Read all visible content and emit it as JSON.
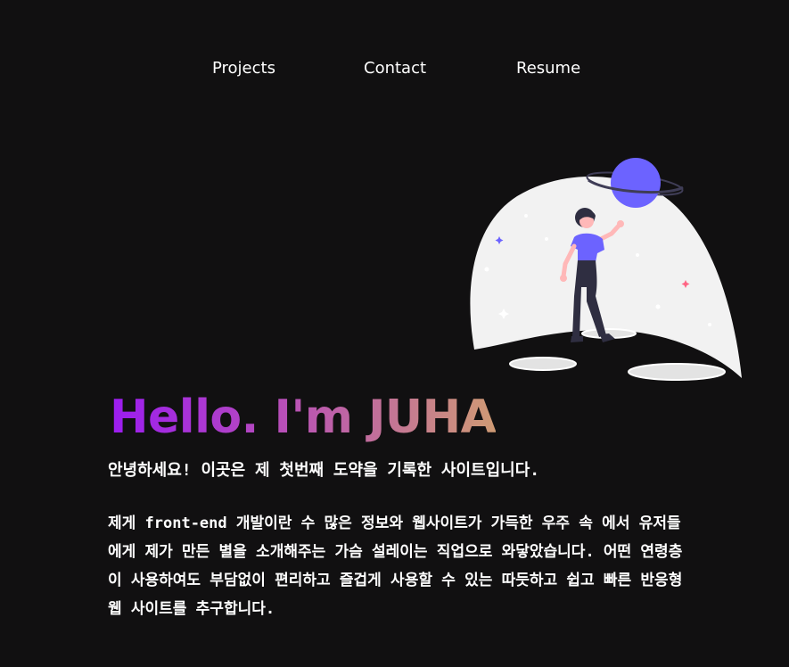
{
  "nav": {
    "items": [
      {
        "label": "Projects"
      },
      {
        "label": "Contact"
      },
      {
        "label": "Resume"
      }
    ]
  },
  "hero": {
    "title": "Hello. I'm JUHA",
    "intro": "안녕하세요! 이곳은 제 첫번째 도약을 기록한 사이트입니다.",
    "description": "제게 front-end 개발이란 수 많은 정보와 웹사이트가 가득한 우주 속 에서 유저들에게 제가 만든 별을 소개해주는 가슴 설레이는 직업으로 와닿았습니다. 어떤 연령층이 사용하여도 부담없이 편리하고 즐겁게 사용할 수 있는 따듯하고 쉽고 빠른 반응형 웹 사이트를 추구합니다."
  },
  "theme": {
    "background": "#111011",
    "planet_color": "#6c63ff",
    "title_gradient": [
      "#9b1cf0",
      "#b84fb8",
      "#cf9a74"
    ],
    "text_color": "#ffffff"
  },
  "illustration": {
    "icon": "astronaut-girl-planet-illustration"
  }
}
